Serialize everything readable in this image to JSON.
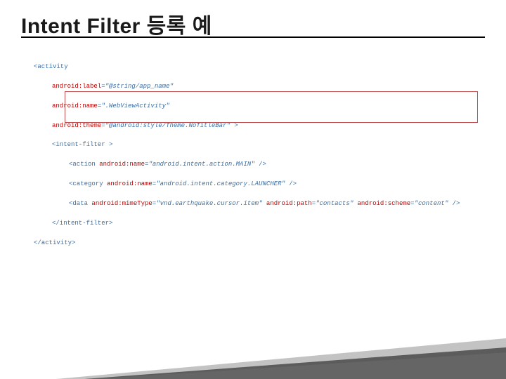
{
  "title": "Intent Filter 등록 예",
  "code": {
    "line1": {
      "tag_open": "<activity"
    },
    "line2": {
      "attr": "android:label",
      "val": "\"@string/app_name\""
    },
    "line3": {
      "attr": "android:name",
      "val": "\".WebViewActivity\""
    },
    "line4": {
      "attr": "android:theme",
      "val": "\"@android:style/Theme.NoTitleBar\"",
      "close": " >"
    },
    "line5": {
      "tag": "<intent-filter >"
    },
    "line6": {
      "tag": "<action",
      "attr1": "android:name",
      "val1": "\"android.intent.action.MAIN\"",
      "end": " />"
    },
    "line7": {
      "tag": "<category",
      "attr1": "android:name",
      "val1": "\"android.intent.category.LAUNCHER\"",
      "end": " />"
    },
    "line8": {
      "tag": "<data",
      "attr1": "android:mimeType",
      "val1": "\"vnd.earthquake.cursor.item\"",
      "attr2": "android:path",
      "val2": "\"contacts\"",
      "attr3": "android:scheme",
      "val3": "\"content\"",
      "end": " />"
    },
    "line9": {
      "tag": "</intent-filter>"
    },
    "line10": {
      "tag": "</activity>"
    }
  }
}
